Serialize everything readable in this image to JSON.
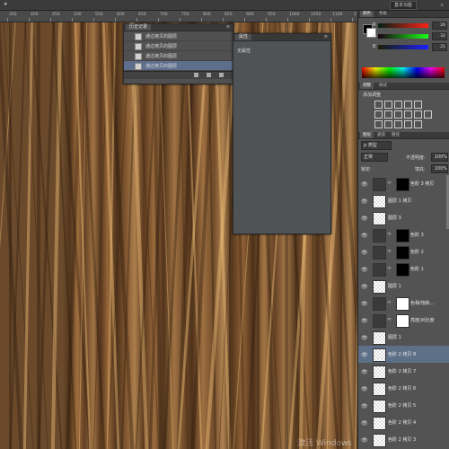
{
  "options_bar": {
    "ticks": [
      "0",
      "50",
      "100",
      "150",
      "200",
      "250",
      "300",
      "350",
      "400",
      "450",
      "500",
      "550",
      "600",
      "650",
      "700",
      "750",
      "800"
    ],
    "workspace": "基本功能"
  },
  "ruler": {
    "ticks": [
      "350",
      "400",
      "450",
      "500",
      "550",
      "600",
      "650",
      "700",
      "750",
      "800",
      "850",
      "900",
      "950",
      "1000",
      "1050",
      "1100",
      "1150"
    ]
  },
  "history": {
    "title": "历史记录",
    "items": [
      "通过拷贝的图层",
      "通过拷贝的图层",
      "通过拷贝的图层",
      "通过拷贝的图层"
    ],
    "selected_index": 3
  },
  "properties": {
    "title": "属性",
    "empty_text": "无属性"
  },
  "color_panel": {
    "tabs": [
      "颜色",
      "色板"
    ],
    "sliders": [
      {
        "label": "R",
        "value": "26"
      },
      {
        "label": "G",
        "value": "32"
      },
      {
        "label": "B",
        "value": "21"
      }
    ],
    "foreground": "#000000",
    "background": "#ffffff"
  },
  "adjustments": {
    "tabs": [
      "调整",
      "样式"
    ],
    "title": "添加调整"
  },
  "layers_panel": {
    "tabs": [
      "图层",
      "通道",
      "路径"
    ],
    "kind_filter": "ρ 类型",
    "blend_mode": "正常",
    "opacity_label": "不透明度:",
    "opacity_value": "100%",
    "lock_label": "锁定:",
    "fill_label": "填充:",
    "fill_value": "100%",
    "layers": [
      {
        "name": "色阶 3 拷贝",
        "kind": "adjustment",
        "mask": "#000000",
        "selected": false
      },
      {
        "name": "图层 1 拷贝",
        "kind": "pixel",
        "mask": null,
        "selected": false
      },
      {
        "name": "图层 3",
        "kind": "pixel",
        "mask": null,
        "selected": false
      },
      {
        "name": "色阶 3",
        "kind": "adjustment",
        "mask": "#000000",
        "selected": false
      },
      {
        "name": "色阶 2",
        "kind": "adjustment",
        "mask": "#000000",
        "selected": false
      },
      {
        "name": "色阶 1",
        "kind": "adjustment",
        "mask": "#000000",
        "selected": false
      },
      {
        "name": "图层 1",
        "kind": "pixel",
        "mask": null,
        "selected": false
      },
      {
        "name": "色相/饱和...",
        "kind": "adjustment",
        "mask": "#ffffff",
        "selected": false
      },
      {
        "name": "亮度/对比度",
        "kind": "adjustment",
        "mask": "#ffffff",
        "selected": false
      },
      {
        "name": "图层 1",
        "kind": "pixel",
        "mask": null,
        "selected": false
      },
      {
        "name": "色阶 2 拷贝 8",
        "kind": "pixel",
        "mask": null,
        "selected": true
      },
      {
        "name": "色阶 2 拷贝 7",
        "kind": "pixel",
        "mask": null,
        "selected": false
      },
      {
        "name": "色阶 2 拷贝 6",
        "kind": "pixel",
        "mask": null,
        "selected": false
      },
      {
        "name": "色阶 2 拷贝 5",
        "kind": "pixel",
        "mask": null,
        "selected": false
      },
      {
        "name": "色阶 2 拷贝 4",
        "kind": "pixel",
        "mask": null,
        "selected": false
      },
      {
        "name": "色阶 2 拷贝 3",
        "kind": "pixel",
        "mask": null,
        "selected": false
      }
    ]
  },
  "watermark": "激活 Windows"
}
